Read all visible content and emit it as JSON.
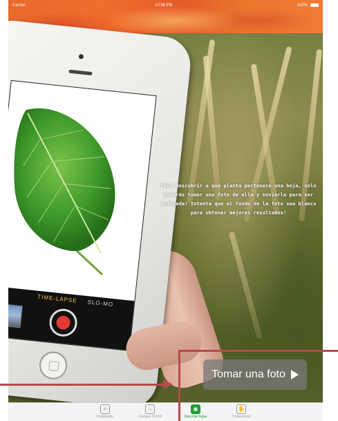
{
  "status_bar": {
    "carrier": "Carrier",
    "time": "10:38 PM",
    "battery": "100%"
  },
  "camera": {
    "mode_active": "TIME-LAPSE",
    "mode_other": "SLO-MO"
  },
  "info_text": "Para descubrir a que planta pertenece una hoja, solo deberás tomar una foto de ella y enviarla para ser evaluada! Intenta que el fondo de la foto sea blanco para obtener mejores resultados!",
  "take_photo_button": {
    "label": "Tomar una foto"
  },
  "tab_bar": {
    "items": [
      {
        "label": "Explorador",
        "icon": "document-icon"
      },
      {
        "label": "Campus PUCP",
        "icon": "map-icon"
      },
      {
        "label": "Describe hojas",
        "icon": "camera-icon"
      },
      {
        "label": "Contactanos",
        "icon": "hand-icon"
      }
    ],
    "active_index": 2
  },
  "colors": {
    "accent": "#1d9e2f",
    "arrow": "#b64a4a",
    "status_bar": "#ee6a2c"
  }
}
